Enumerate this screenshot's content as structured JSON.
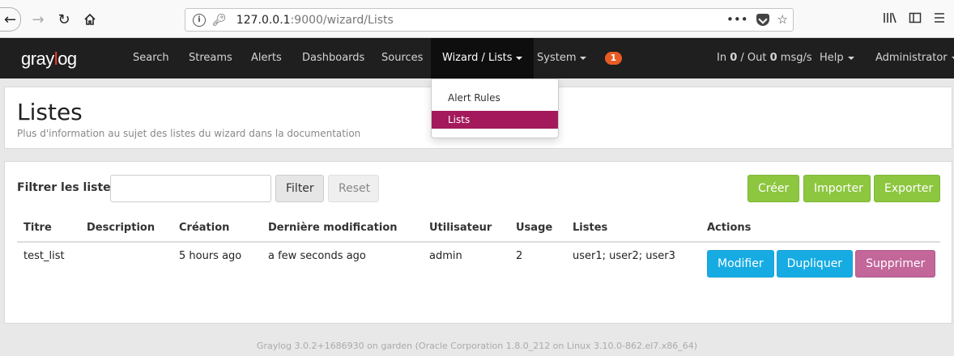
{
  "browser": {
    "url_host": "127.0.0.1",
    "url_rest": ":9000/wizard/Lists",
    "more_label": "•••"
  },
  "navbar": {
    "logo_prefix": "gray",
    "logo_o": "l",
    "logo_suffix": "og",
    "items": {
      "search": "Search",
      "streams": "Streams",
      "alerts": "Alerts",
      "dashboards": "Dashboards",
      "sources": "Sources",
      "wizard": "Wizard / Lists",
      "system": "System"
    },
    "notification_count": "1",
    "throughput_in_label": "In ",
    "throughput_in": "0",
    "throughput_out_label": " / Out ",
    "throughput_out": "0",
    "throughput_unit": " msg/s",
    "help": "Help",
    "user": "Administrator"
  },
  "dropdown": {
    "items": [
      "Alert Rules",
      "Lists"
    ],
    "selected": "Lists"
  },
  "header": {
    "title": "Listes",
    "subtitle": "Plus d'information au sujet des listes du wizard dans la documentation"
  },
  "toolbar": {
    "filter_label": "Filtrer les listes",
    "filter_value": "",
    "filter_button": "Filter",
    "reset_button": "Reset",
    "create_button": "Créer",
    "import_button": "Importer",
    "export_button": "Exporter"
  },
  "table": {
    "columns": [
      "Titre",
      "Description",
      "Création",
      "Dernière modification",
      "Utilisateur",
      "Usage",
      "Listes",
      "Actions"
    ],
    "rows": [
      {
        "title": "test_list",
        "description": "",
        "created": "5 hours ago",
        "modified": "a few seconds ago",
        "user": "admin",
        "usage": "2",
        "lists": "user1; user2; user3",
        "actions": {
          "edit": "Modifier",
          "duplicate": "Dupliquer",
          "delete": "Supprimer"
        }
      }
    ]
  },
  "footer": {
    "text": "Graylog 3.0.2+1686930 on garden (Oracle Corporation 1.8.0_212 on Linux 3.10.0-862.el7.x86_64)"
  },
  "colors": {
    "navbar_bg": "#1f1f1f",
    "accent_selected": "#a3195b",
    "primary_green": "#8dc63f",
    "info_blue": "#16ace3",
    "danger_pink": "#c3669a",
    "badge_orange": "#e85c24"
  }
}
